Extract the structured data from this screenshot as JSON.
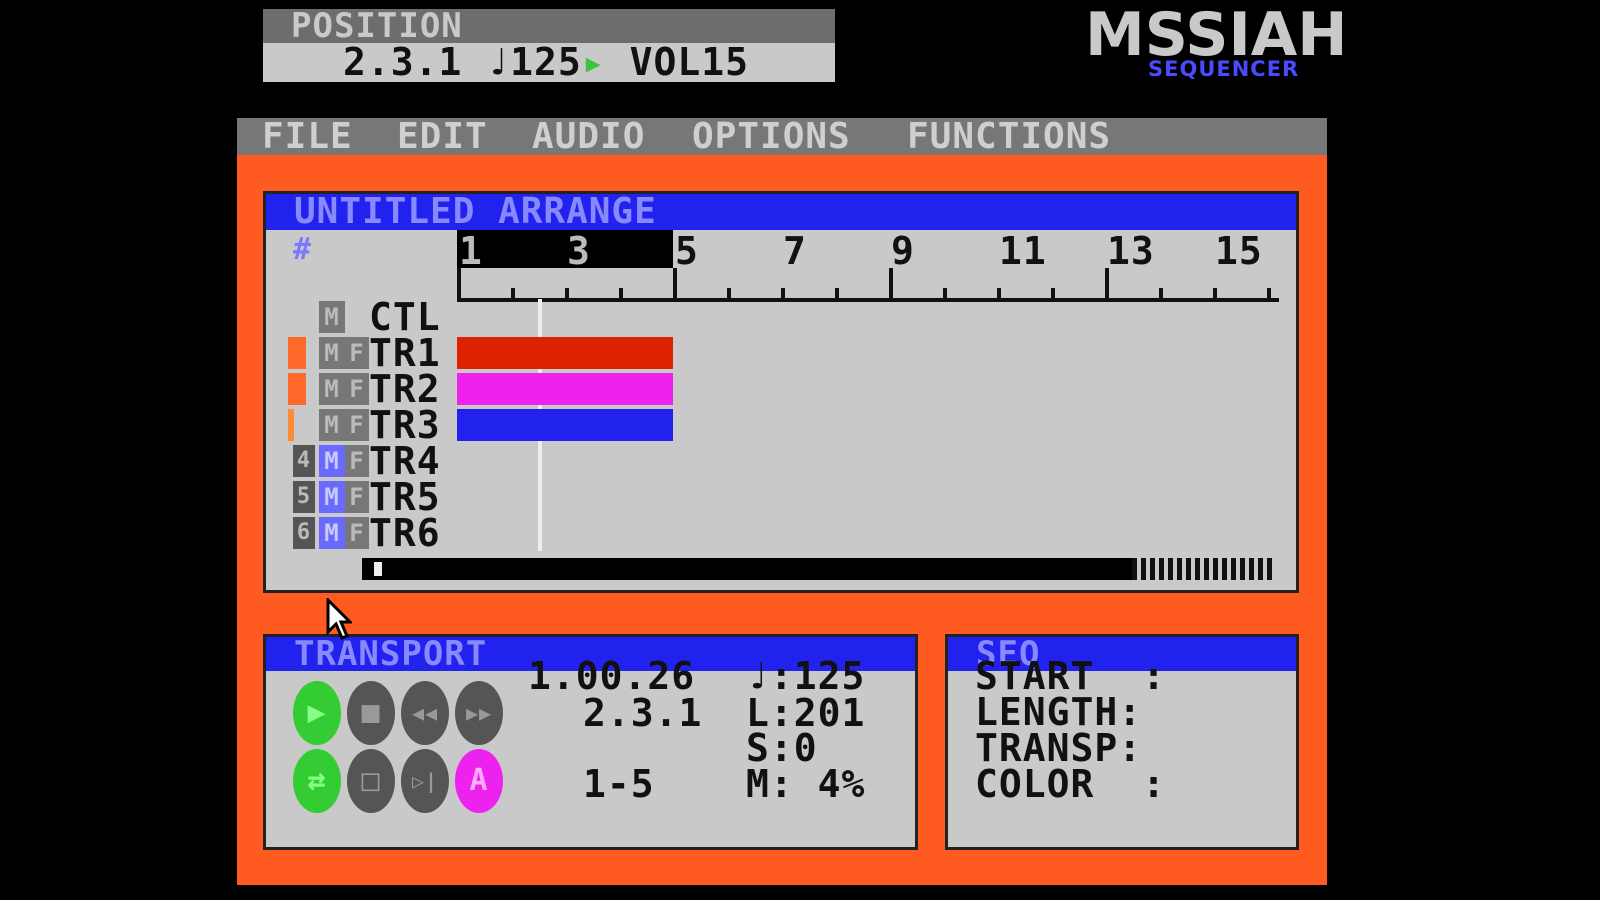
{
  "position": {
    "title": "POSITION",
    "bar_pos": "2.3.1",
    "tempo_label": "♩125",
    "indicator": "▸",
    "volume": "VOL15"
  },
  "logo": {
    "main": "MSSIAH",
    "sub": "SEQUENCER"
  },
  "menu": [
    "FILE",
    "EDIT",
    "AUDIO",
    "OPTIONS",
    "FUNCTIONS"
  ],
  "arrange": {
    "title": "UNTITLED ARRANGE",
    "hash": "#",
    "bar_numbers": [
      "1",
      "3",
      "5",
      "7",
      "9",
      "11",
      "13",
      "15"
    ],
    "loop_range_bars": [
      1,
      5
    ],
    "tracks": [
      {
        "name": "CTL",
        "channel": "",
        "mute": "M",
        "fx": "",
        "flag_color": "",
        "pattern_color": "",
        "pattern_bars": [
          0,
          0
        ]
      },
      {
        "name": "TR1",
        "channel": "",
        "mute": "M",
        "fx": "F",
        "flag_color": "#ff6a2a",
        "pattern_color": "#dd2200",
        "pattern_bars": [
          1,
          5
        ]
      },
      {
        "name": "TR2",
        "channel": "",
        "mute": "M",
        "fx": "F",
        "flag_color": "#ff6a2a",
        "pattern_color": "#ee22ee",
        "pattern_bars": [
          1,
          5
        ]
      },
      {
        "name": "TR3",
        "channel": "",
        "mute": "M",
        "fx": "F",
        "flag_color": "#ff8a3a",
        "pattern_color": "#2222ee",
        "pattern_bars": [
          1,
          5
        ]
      },
      {
        "name": "TR4",
        "channel": "4",
        "mute": "M",
        "fx": "F",
        "flag_color": "",
        "pattern_color": "",
        "pattern_bars": [
          0,
          0
        ]
      },
      {
        "name": "TR5",
        "channel": "5",
        "mute": "M",
        "fx": "F",
        "flag_color": "",
        "pattern_color": "",
        "pattern_bars": [
          0,
          0
        ]
      },
      {
        "name": "TR6",
        "channel": "6",
        "mute": "M",
        "fx": "F",
        "flag_color": "",
        "pattern_color": "",
        "pattern_bars": [
          0,
          0
        ]
      }
    ],
    "playhead_bar": 2.5
  },
  "transport": {
    "title": "TRANSPORT",
    "time": "1.00.26",
    "tempo": "♩:125",
    "position": "2.3.1",
    "length": "L:201",
    "s_value": "S:0",
    "range": "1-5",
    "memory": "M: 4%",
    "buttons": [
      {
        "name": "play",
        "glyph": "▶",
        "color": "green"
      },
      {
        "name": "stop",
        "glyph": "■",
        "color": "gray"
      },
      {
        "name": "rewind",
        "glyph": "◀◀",
        "color": "gray"
      },
      {
        "name": "fast-forward",
        "glyph": "▶▶",
        "color": "gray"
      },
      {
        "name": "loop",
        "glyph": "⇄",
        "color": "green"
      },
      {
        "name": "record",
        "glyph": "□",
        "color": "gray"
      },
      {
        "name": "step",
        "glyph": "▷|",
        "color": "gray"
      },
      {
        "name": "auto",
        "glyph": "A",
        "color": "magenta"
      }
    ]
  },
  "seq": {
    "title": "SEQ",
    "rows": [
      "START  :",
      "LENGTH:",
      "TRANSP:",
      "COLOR  :"
    ]
  }
}
